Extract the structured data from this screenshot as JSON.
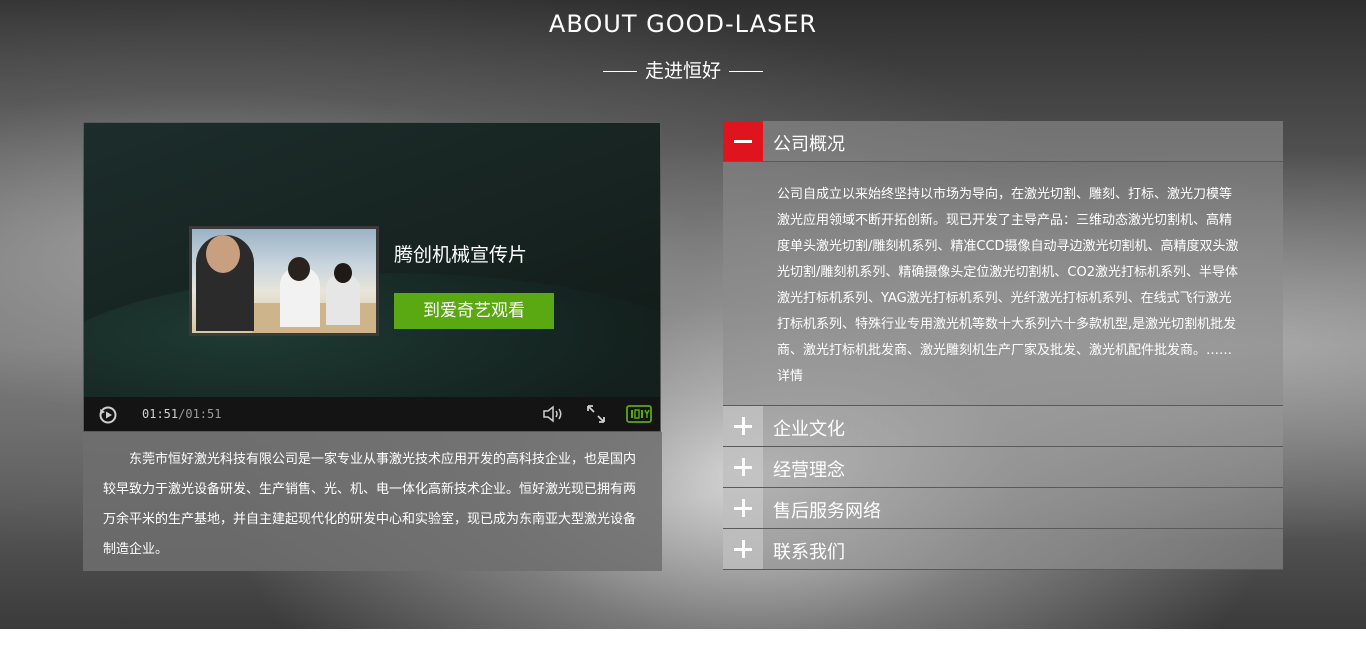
{
  "header": {
    "title": "ABOUT GOOD-LASER",
    "subtitle": "走进恒好"
  },
  "video": {
    "title": "腾创机械宣传片",
    "watch_button": "到爱奇艺观看",
    "time_current": "01:51",
    "time_total": "/01:51",
    "brand_icon": "iqiyi-logo-icon"
  },
  "intro": {
    "text": "东莞市恒好激光科技有限公司是一家专业从事激光技术应用开发的高科技企业，也是国内较早致力于激光设备研发、生产销售、光、机、电一体化高新技术企业。恒好激光现已拥有两万余平米的生产基地，并自主建起现代化的研发中心和实验室，现已成为东南亚大型激光设备制造企业。"
  },
  "accordion": {
    "items": [
      {
        "label": "公司概况",
        "expanded": true
      },
      {
        "label": "企业文化",
        "expanded": false
      },
      {
        "label": "经营理念",
        "expanded": false
      },
      {
        "label": "售后服务网络",
        "expanded": false
      },
      {
        "label": "联系我们",
        "expanded": false
      }
    ],
    "overview_text": "公司自成立以来始终坚持以市场为导向，在激光切割、雕刻、打标、激光刀模等激光应用领域不断开拓创新。现已开发了主导产品：三维动态激光切割机、高精度单头激光切割/雕刻机系列、精准CCD摄像自动寻边激光切割机、高精度双头激光切割/雕刻机系列、精确摄像头定位激光切割机、CO2激光打标机系列、半导体激光打标机系列、YAG激光打标机系列、光纤激光打标机系列、在线式飞行激光打标机系列、特殊行业专用激光机等数十大系列六十多款机型,是激光切割机批发商、激光打标机批发商、激光雕刻机生产厂家及批发、激光机配件批发商。……详情"
  },
  "colors": {
    "accent_red": "#e0141e",
    "button_green": "#5aa812"
  }
}
